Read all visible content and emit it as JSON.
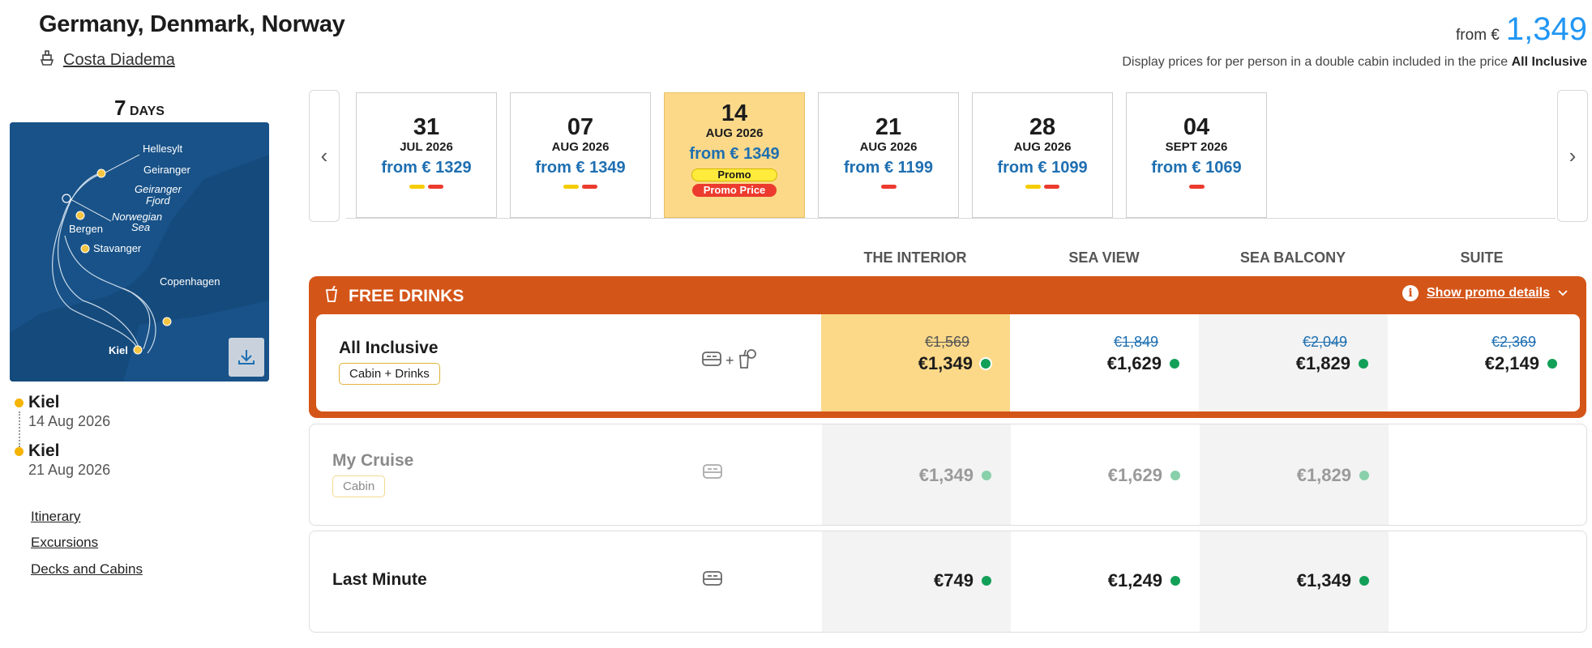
{
  "header": {
    "title": "Germany, Denmark, Norway",
    "ship_name": "Costa Diadema",
    "price_from_label": "from €",
    "price_from_value": "1,349",
    "price_note": "Display prices for per person in a double cabin included in the price",
    "price_note_bold": "All Inclusive"
  },
  "left": {
    "days_number": "7",
    "days_label": "DAYS",
    "map_labels": {
      "hellesylt": "Hellesylt",
      "geiranger": "Geiranger",
      "geiranger_fjord_1": "Geiranger",
      "geiranger_fjord_2": "Fjord",
      "norwegian_sea_1": "Norwegian",
      "norwegian_sea_2": "Sea",
      "bergen": "Bergen",
      "stavanger": "Stavanger",
      "copenhagen": "Copenhagen",
      "kiel": "Kiel"
    },
    "start_port": "Kiel",
    "start_date": "14 Aug 2026",
    "end_port": "Kiel",
    "end_date": "21 Aug 2026",
    "links": [
      "Itinerary",
      "Excursions",
      "Decks and Cabins"
    ]
  },
  "dates": [
    {
      "day": "31",
      "month": "JUL 2026",
      "from": "from € 1329",
      "bars": [
        "y",
        "r"
      ]
    },
    {
      "day": "07",
      "month": "AUG 2026",
      "from": "from € 1349",
      "bars": [
        "y",
        "r"
      ]
    },
    {
      "day": "14",
      "month": "AUG 2026",
      "from": "from € 1349",
      "selected": true,
      "promo": "Promo",
      "promo_price": "Promo Price"
    },
    {
      "day": "21",
      "month": "AUG 2026",
      "from": "from € 1199",
      "bars": [
        "r"
      ]
    },
    {
      "day": "28",
      "month": "AUG 2026",
      "from": "from € 1099",
      "bars": [
        "y",
        "r"
      ]
    },
    {
      "day": "04",
      "month": "SEPT 2026",
      "from": "from € 1069",
      "bars": [
        "r"
      ]
    }
  ],
  "cabin_types": [
    "THE INTERIOR",
    "SEA VIEW",
    "SEA BALCONY",
    "SUITE"
  ],
  "promo": {
    "title": "FREE DRINKS",
    "details_link": "Show promo details",
    "icon": "drink-cup-icon"
  },
  "fares": [
    {
      "name": "All Inclusive",
      "badge": "Cabin + Drinks",
      "icons": [
        "bed-icon",
        "drinks-icon"
      ],
      "plus": "+",
      "prices": [
        {
          "old": "€1,569",
          "price": "€1,349"
        },
        {
          "old": "€1,849",
          "price": "€1,629"
        },
        {
          "old": "€2,049",
          "price": "€1,829"
        },
        {
          "old": "€2,369",
          "price": "€2,149"
        }
      ]
    },
    {
      "name": "My Cruise",
      "badge": "Cabin",
      "icons": [
        "bed-icon"
      ],
      "prices": [
        {
          "price": "€1,349"
        },
        {
          "price": "€1,629"
        },
        {
          "price": "€1,829"
        }
      ]
    },
    {
      "name": "Last Minute",
      "icons": [
        "bed-icon"
      ],
      "prices": [
        {
          "price": "€749"
        },
        {
          "price": "€1,249"
        },
        {
          "price": "€1,349"
        }
      ]
    }
  ],
  "colors": {
    "accent_blue": "#2196f3",
    "price_blue": "#1e6fb1",
    "promo_orange": "#d45518",
    "selected_gold": "#fcd989",
    "availability_green": "#12a058",
    "promo_yellow": "#ffeb3b",
    "promo_red": "#ec3b2e"
  }
}
